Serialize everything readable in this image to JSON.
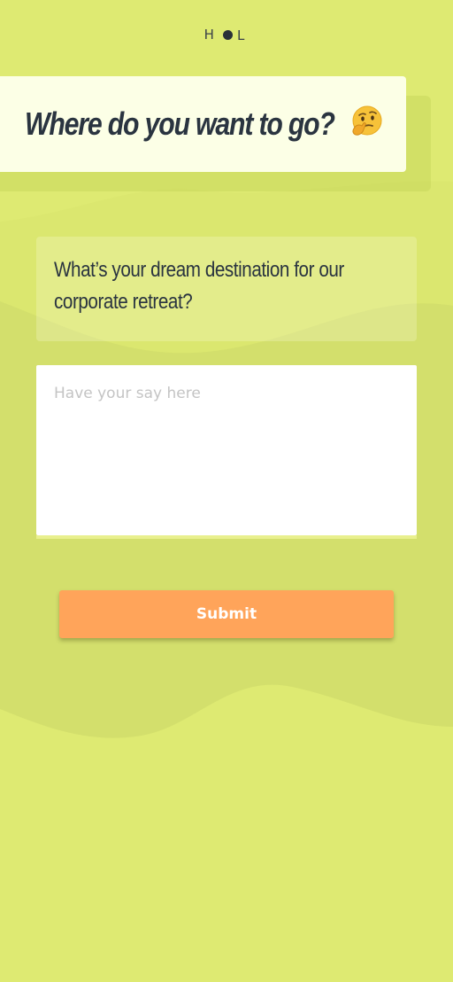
{
  "brand": {
    "logo_left": "H",
    "logo_right": "L"
  },
  "survey": {
    "title": "Where do you want to go?",
    "title_emoji": "thinking-face-emoji",
    "question": "What’s your dream destination for our corporate retreat?",
    "answer_value": "",
    "answer_placeholder": "Have your say here",
    "submit_label": "Submit"
  },
  "colors": {
    "background": "#deea72",
    "background_wave": "#d3df6c",
    "title_card": "#fcffe6",
    "text_dark": "#2a3440",
    "submit_button": "#ffa45a",
    "placeholder": "#c4c4c4"
  }
}
